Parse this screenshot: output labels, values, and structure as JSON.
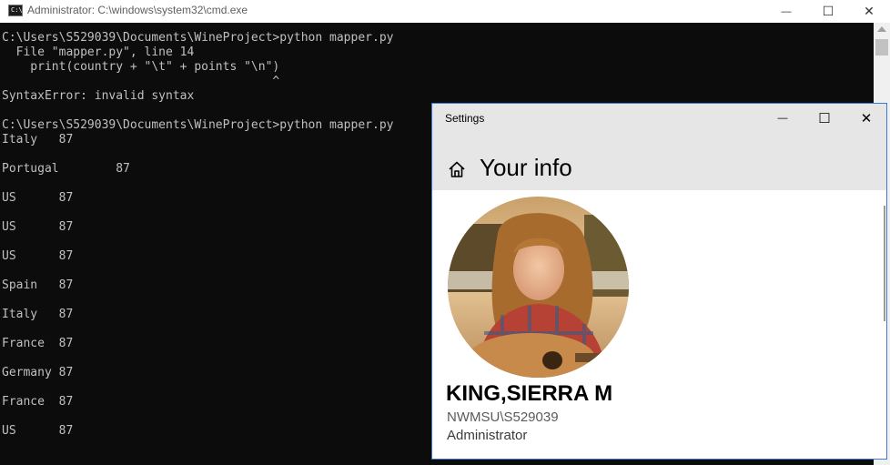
{
  "cmd": {
    "title": "Administrator: C:\\windows\\system32\\cmd.exe",
    "icon_text": "C:\\",
    "lines": [
      "",
      "C:\\Users\\S529039\\Documents\\WineProject>python mapper.py",
      "  File \"mapper.py\", line 14",
      "    print(country + \"\\t\" + points \"\\n\")",
      "                                      ^",
      "SyntaxError: invalid syntax",
      "",
      "C:\\Users\\S529039\\Documents\\WineProject>python mapper.py",
      "Italy   87",
      "",
      "Portugal        87",
      "",
      "US      87",
      "",
      "US      87",
      "",
      "US      87",
      "",
      "Spain   87",
      "",
      "Italy   87",
      "",
      "France  87",
      "",
      "Germany 87",
      "",
      "France  87",
      "",
      "US      87"
    ]
  },
  "settings": {
    "title": "Settings",
    "heading": "Your info",
    "user": {
      "name": "KING,SIERRA M",
      "account": "NWMSU\\S529039",
      "role": "Administrator"
    }
  },
  "window_controls": {
    "minimize": "—",
    "maximize": "☐",
    "close": "✕"
  }
}
